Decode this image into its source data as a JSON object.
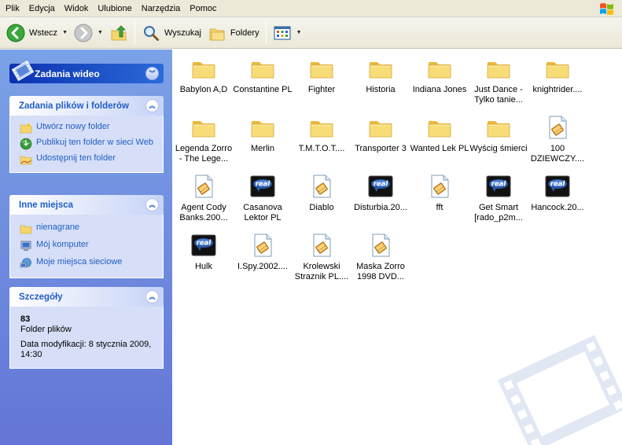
{
  "menu": [
    "Plik",
    "Edycja",
    "Widok",
    "Ulubione",
    "Narzędzia",
    "Pomoc"
  ],
  "toolbar": {
    "back_label": "Wstecz",
    "search_label": "Wyszukaj",
    "folders_label": "Foldery"
  },
  "taskpane": {
    "video_tasks": {
      "title": "Zadania wideo"
    },
    "file_tasks": {
      "title": "Zadania plików i folderów",
      "items": [
        "Utwórz nowy folder",
        "Publikuj ten folder w sieci Web",
        "Udostępnij ten folder"
      ]
    },
    "other_places": {
      "title": "Inne miejsca",
      "items": [
        "nienagrane",
        "Mój komputer",
        "Moje miejsca sieciowe"
      ]
    },
    "details": {
      "title": "Szczegóły",
      "name": "83",
      "type": "Folder plików",
      "modified": "Data modyfikacji: 8 stycznia 2009, 14:30"
    }
  },
  "files": [
    {
      "name": "Babylon A,D",
      "type": "folder"
    },
    {
      "name": "Constantine PL",
      "type": "folder"
    },
    {
      "name": "Fighter",
      "type": "folder"
    },
    {
      "name": "Historia",
      "type": "folder"
    },
    {
      "name": "Indiana Jones",
      "type": "folder"
    },
    {
      "name": "Just Dance - Tylko tanie...",
      "type": "folder"
    },
    {
      "name": "knightrider....",
      "type": "folder"
    },
    {
      "name": "Legenda Zorro - The Lege...",
      "type": "folder"
    },
    {
      "name": "Merlin",
      "type": "folder"
    },
    {
      "name": "T.M.T.O.T....",
      "type": "folder"
    },
    {
      "name": "Transporter 3",
      "type": "folder"
    },
    {
      "name": "Wanted Lek PL",
      "type": "folder"
    },
    {
      "name": "Wyścig śmierci",
      "type": "folder"
    },
    {
      "name": "100 DZIEWCZY....",
      "type": "video"
    },
    {
      "name": "Agent Cody Banks.200...",
      "type": "video"
    },
    {
      "name": "Casanova Lektor PL",
      "type": "real"
    },
    {
      "name": "Diablo",
      "type": "video"
    },
    {
      "name": "Disturbia.20...",
      "type": "real"
    },
    {
      "name": "fft",
      "type": "video"
    },
    {
      "name": "Get Smart [rado_p2m...",
      "type": "real"
    },
    {
      "name": "Hancock.20...",
      "type": "real"
    },
    {
      "name": "Hulk",
      "type": "real"
    },
    {
      "name": "I.Spy.2002....",
      "type": "video"
    },
    {
      "name": "Krolewski Straznik PL....",
      "type": "video"
    },
    {
      "name": "Maska Zorro 1998 DVD...",
      "type": "video"
    }
  ],
  "icons": {
    "real_text": "real"
  },
  "colors": {
    "taskpane_top": "#7ba2e7",
    "taskpane_bottom": "#6375d6",
    "link": "#215dc6",
    "folder": "#f5d66b"
  }
}
